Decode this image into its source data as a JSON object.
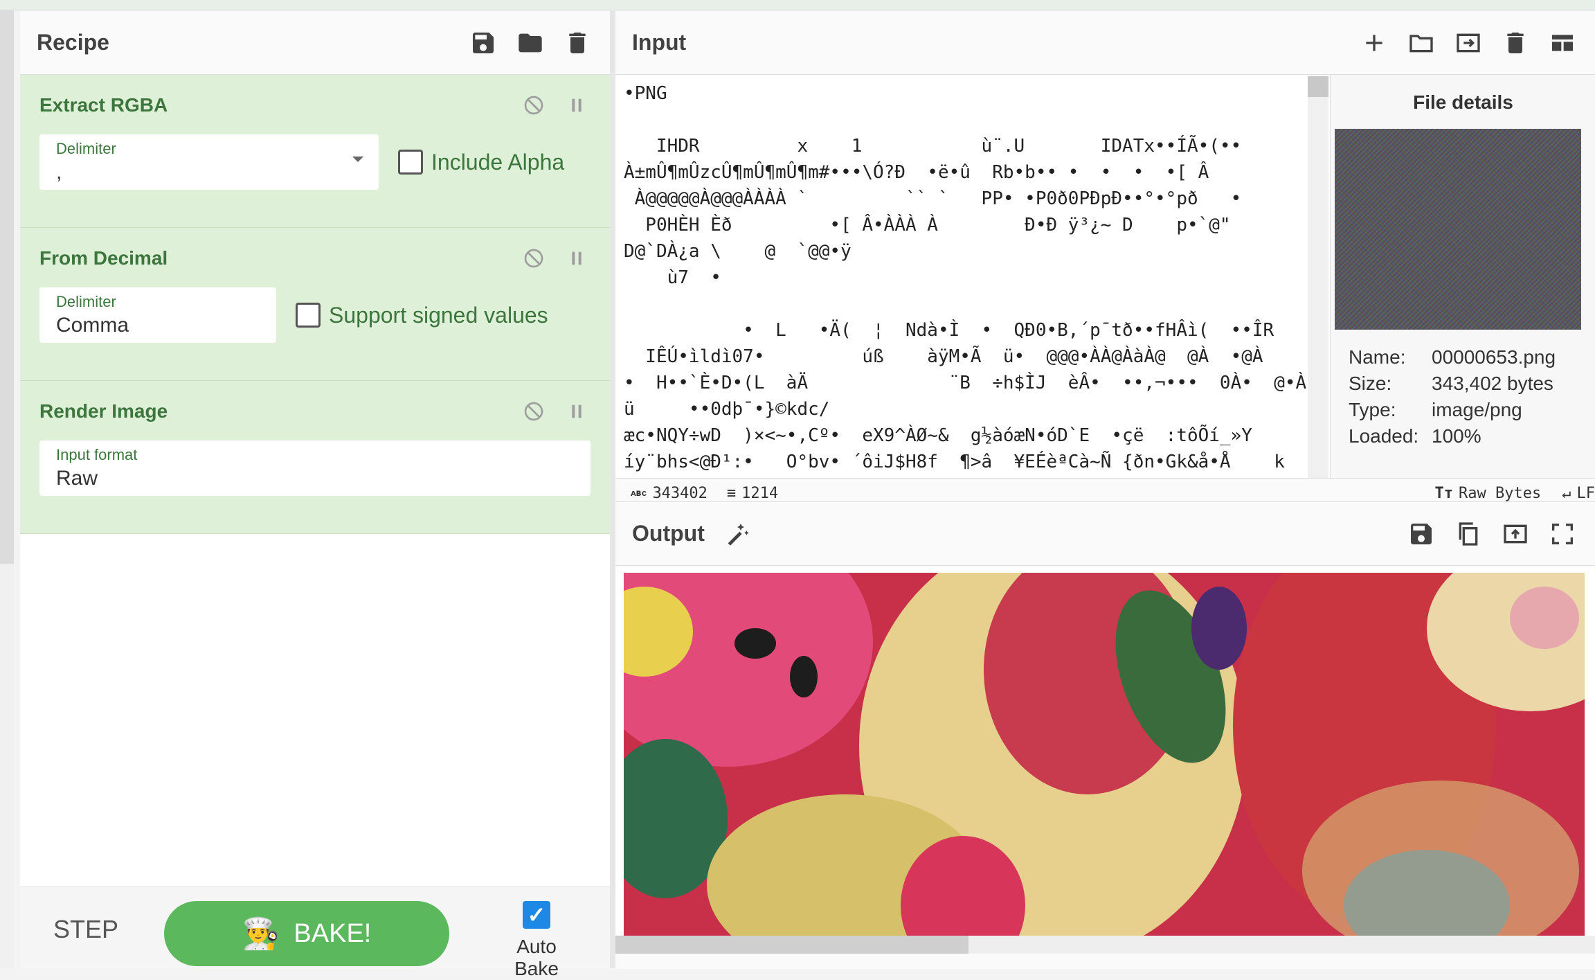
{
  "recipe": {
    "title": "Recipe",
    "operations": [
      {
        "name": "Extract RGBA",
        "args": [
          {
            "label": "Delimiter",
            "value": ",",
            "type": "select"
          }
        ],
        "checkbox": {
          "label": "Include Alpha",
          "checked": false
        }
      },
      {
        "name": "From Decimal",
        "args": [
          {
            "label": "Delimiter",
            "value": "Comma",
            "type": "select"
          }
        ],
        "checkbox": {
          "label": "Support signed values",
          "checked": false
        }
      },
      {
        "name": "Render Image",
        "args": [
          {
            "label": "Input format",
            "value": "Raw",
            "type": "select"
          }
        ]
      }
    ],
    "bake": {
      "step_label": "STEP",
      "bake_label": "BAKE!",
      "autobake_label": "Auto Bake",
      "autobake_checked": true
    }
  },
  "input": {
    "title": "Input",
    "status": {
      "length": "343402",
      "lines": "1214",
      "encoding": "Raw Bytes",
      "eol": "LF"
    }
  },
  "file_details": {
    "title": "File details",
    "name_label": "Name:",
    "name": "00000653.png",
    "size_label": "Size:",
    "size": "343,402 bytes",
    "type_label": "Type:",
    "type": "image/png",
    "loaded_label": "Loaded:",
    "loaded": "100%"
  },
  "output": {
    "title": "Output"
  },
  "raw_bytes_preview": [
    "•PNG",
    "",
    "   IHDR         x    1           ù¨.U       IDATx••ÍÃ•(•• ",
    "À±mÛ¶mÛzcÛ¶mÛ¶mÛ¶m#•••\\Ó?Ð  •ë•û  Rb•b•• •  •  •  •[ Â",
    " À@@@@@À@@@ÀÀÀÀ `         `` `   PP• •P0ð0PÐpÐ••°•°pð   •",
    "  P0HÈH Èð         •[ Â•ÀÀÀ À        Ð•Ð ÿ³¿~ D    p•`@\"",
    "D@`DÀ¿a \\    @  `@@•ÿ             ",
    "    ù7  •            ",
    "",
    "           •  L   •Ä(  ¦  Ndà•Ì  •  QÐ0•B,´p¯tð••fHÂì(  ••ÎR",
    "  IÊÚ•ìldì07•         úß    àÿM•Ã  ü•  @@@•ÀÀ@ÀàÀ@  @À  •@À",
    "•  H••`È•D•(L  àÄ             ¨B  ÷h$ÌJ  èÂ•  ••,¬•••  0À•  @•À• ",
    "ü     ••0dþ¯•}©kdc/",
    "æc•NQY÷wD  )×<~•,Cº•  eX9^ÀØ~&  g½àóæN•óD`E  •çë  :tôÕí_»Y ",
    "íy¨bhs<@Ð¹:•   O°bv• ´ôiJ$H8f  ¶>â  ¥EÉèªCà~Ñ {ðn•Gk&å•Å    k  •"
  ]
}
